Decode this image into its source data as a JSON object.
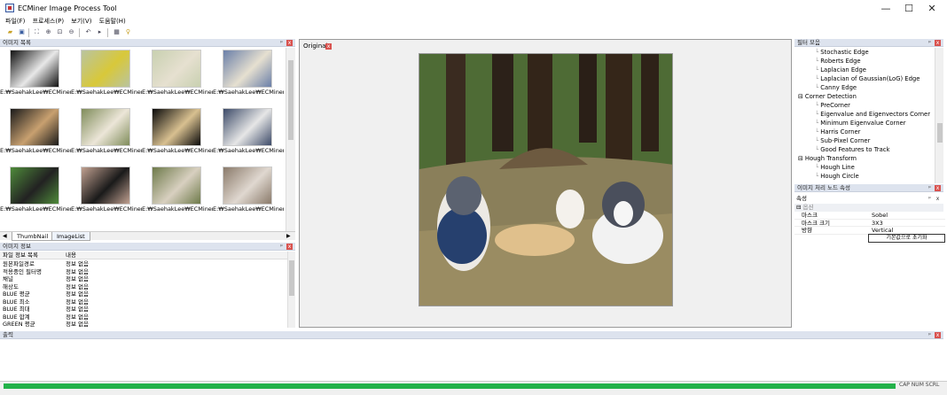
{
  "window": {
    "title": "ECMiner Image Process Tool",
    "minimize": "—",
    "maximize": "☐",
    "close": "✕"
  },
  "menu": [
    "파일(F)",
    "프로세스(P)",
    "보기(V)",
    "도움말(H)"
  ],
  "image_list_panel": {
    "title": "이미지 목록",
    "pin": "ᵖ",
    "close": "x",
    "thumbnails": [
      {
        "caption": "E:₩SaehakLee₩ECMiner..."
      },
      {
        "caption": "E:₩SaehakLee₩ECMiner..."
      },
      {
        "caption": "E:₩SaehakLee₩ECMiner..."
      },
      {
        "caption": "E:₩SaehakLee₩ECMiner..."
      },
      {
        "caption": "E:₩SaehakLee₩ECMiner..."
      },
      {
        "caption": "E:₩SaehakLee₩ECMiner..."
      },
      {
        "caption": "E:₩SaehakLee₩ECMiner..."
      },
      {
        "caption": "E:₩SaehakLee₩ECMiner..."
      },
      {
        "caption": "E:₩SaehakLee₩ECMiner..."
      },
      {
        "caption": "E:₩SaehakLee₩ECMiner..."
      },
      {
        "caption": "E:₩SaehakLee₩ECMiner..."
      },
      {
        "caption": "E:₩SaehakLee₩ECMiner..."
      }
    ],
    "tabs": [
      "ThumbNail",
      "ImageList"
    ]
  },
  "image_info_panel": {
    "title": "이미지 정보",
    "pin": "ᵖ",
    "close": "x",
    "columns": [
      "파일 정보 목록",
      "내용"
    ],
    "rows": [
      [
        "원본파일경로",
        "정보 없음"
      ],
      [
        "적용중인 필터명",
        "정보 없음"
      ],
      [
        "채널",
        "정보 없음"
      ],
      [
        "해상도",
        "정보 없음"
      ],
      [
        "BLUE 평균",
        "정보 없음"
      ],
      [
        "BLUE 최소",
        "정보 없음"
      ],
      [
        "BLUE 최대",
        "정보 없음"
      ],
      [
        "BLUE 합계",
        "정보 없음"
      ],
      [
        "GREEN 평균",
        "정보 없음"
      ]
    ]
  },
  "image_view": {
    "tab": "Original",
    "tab_close": "x"
  },
  "filter_panel": {
    "title": "필터 모음",
    "pin": "ᵖ",
    "close": "x",
    "items": [
      {
        "label": "Stochastic Edge",
        "level": 2
      },
      {
        "label": "Roberts Edge",
        "level": 2
      },
      {
        "label": "Laplacian Edge",
        "level": 2
      },
      {
        "label": "Laplacian of Gaussian(LoG) Edge",
        "level": 2
      },
      {
        "label": "Canny Edge",
        "level": 2
      },
      {
        "label": "Corner Detection",
        "level": 1
      },
      {
        "label": "PreCorner",
        "level": 2
      },
      {
        "label": "Eigenvalue and Eigenvectors Corner",
        "level": 2
      },
      {
        "label": "Minimum Eigenvalue Corner",
        "level": 2
      },
      {
        "label": "Harris Corner",
        "level": 2
      },
      {
        "label": "Sub-Pixel Corner",
        "level": 2
      },
      {
        "label": "Good Features to Track",
        "level": 2
      },
      {
        "label": "Hough Transform",
        "level": 1
      },
      {
        "label": "Hough Line",
        "level": 2
      },
      {
        "label": "Hough Circle",
        "level": 2
      }
    ]
  },
  "node_prop_panel": {
    "title": "이미지 처리 노드 속성",
    "pin": "ᵖ",
    "close": "x"
  },
  "property_panel": {
    "title": "속성",
    "pin": "ᵖ",
    "close": "x",
    "group": "옵션",
    "rows": [
      [
        "마스크",
        "Sobel"
      ],
      [
        "마스크 크기",
        "3X3"
      ],
      [
        "방향",
        "Vertical"
      ]
    ],
    "reset_button": "기본값으로 초기화"
  },
  "output_panel": {
    "title": "출력",
    "pin": "ᵖ",
    "close": "x"
  },
  "status": {
    "progress": 1.0,
    "indicators": "CAP NUM SCRL"
  }
}
